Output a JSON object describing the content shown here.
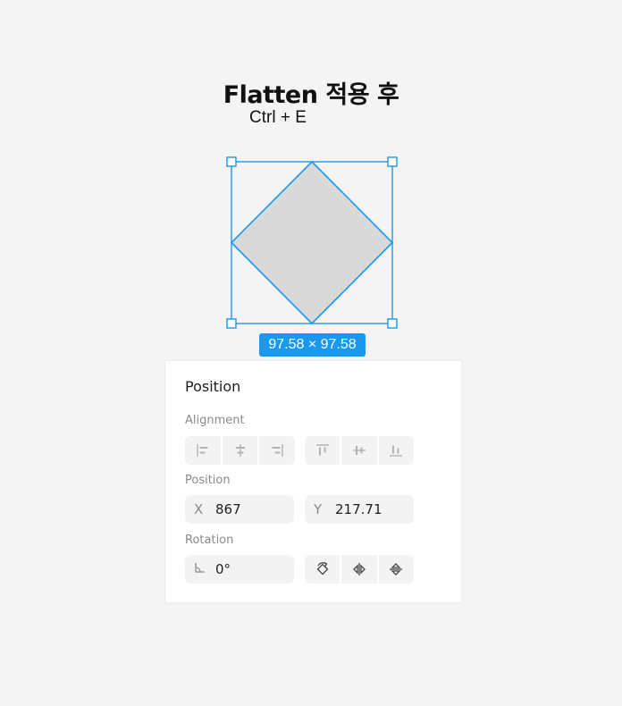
{
  "header": {
    "title": "Flatten 적용 후",
    "shortcut": "Ctrl + E"
  },
  "selection": {
    "dimensions": "97.58 × 97.58",
    "fill_color": "#d9d9d9",
    "selection_color": "#1a98ee"
  },
  "panel": {
    "title": "Position",
    "alignment_label": "Alignment",
    "position_label": "Position",
    "rotation_label": "Rotation",
    "x_label": "X",
    "x_value": "867",
    "y_label": "Y",
    "y_value": "217.71",
    "rotation_value": "0°",
    "alignment_icons": [
      "align-left-icon",
      "align-horizontal-center-icon",
      "align-right-icon",
      "align-top-icon",
      "align-vertical-center-icon",
      "align-bottom-icon"
    ],
    "transform_icons": [
      "rotate-90-icon",
      "flip-horizontal-icon",
      "flip-vertical-icon"
    ]
  }
}
